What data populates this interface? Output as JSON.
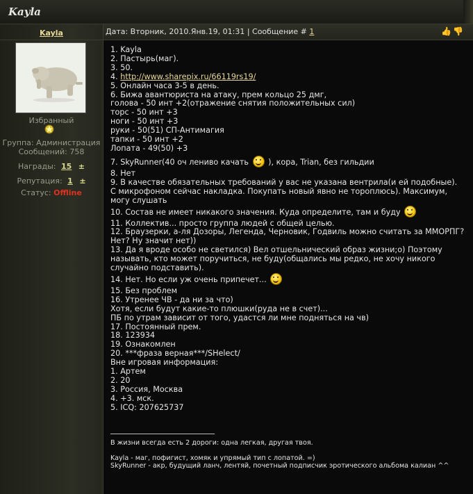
{
  "topbar": {
    "title": "Kayla"
  },
  "sidebar": {
    "username": "Kayla",
    "rank": "Избранный",
    "group_label": "Группа:",
    "group_value": "Администрация",
    "posts_label": "Сообщений:",
    "posts_value": "758",
    "awards_label": "Награды:",
    "awards_value": "15",
    "reputation_label": "Репутация:",
    "reputation_value": "1",
    "plus": "±",
    "status_label": "Статус:",
    "status_value": "Offline"
  },
  "post_header": {
    "date_text": "Дата: Вторник, 2010.Янв.19, 01:31 | Сообщение #",
    "message_number": "1"
  },
  "content": {
    "l1": "1. Kayla",
    "l2": "2. Пастырь(маг).",
    "l3": "3. 50.",
    "l4_prefix": "4. ",
    "l4_link": "http://www.sharepix.ru/66119rs19/",
    "l5": "5. Онлайн часа 3-5 в день.",
    "l6": "6. Бижа авантюриста на атаку, прем кольцо 25 дмг,",
    "l6b": "голова - 50 инт +2(отражение снятия положительных сил)",
    "l6c": "торс - 50 инт +3",
    "l6d": "ноги - 50 инт +3",
    "l6e": "руки - 50(51) СП-Антимагия",
    "l6f": "тапки - 50 инт +2",
    "l6g": "Лопата - 49(50) +3",
    "l7a": "7. SkyRunner(40 оч лениво качать",
    "l7b": "), кора, Trian, без гильдии",
    "l8": "8. Нет",
    "l9": "9. В качестве обязательных требований у вас не указана вентрила(и ей подобные). С микрофоном сейчас накладка. Покупать новый явно не тороплюсь). Максимум, могу слушать",
    "l10": "10. Состав не имеет никакого значения. Куда определите, там и буду",
    "l11": "11. Коллектив... просто группа людей с общей целью.",
    "l12": "12. Браузерки, а-ля Дозоры, Легенда, Черновик, Годвиль можно считать за ММОРПГ? Нет? Ну значит нет))",
    "l13": "13. Да я вроде особо не светился) Вел отшельнический образ жизни;о) Поэтому называть, кто может поручиться, не буду(общались мы редко, не хочу никого случайно подставить).",
    "l14": "14. Нет. Но если уж очень припечет...",
    "l15": "15. Без проблем",
    "l16": "16. Утренее ЧВ - да ни за что)",
    "l16b": "Хотя, если будут какие-то плюшки(руда не в счет)...",
    "l16c": "ПБ по утрам зависит от того, удастся ли мне подняться на чв)",
    "l17": "17. Постоянный прем.",
    "l18": "18. 123934",
    "l19": "19. Ознакомлен",
    "l20": "20. ***фраза верная***/SHelect/",
    "offgame": "Вне игровая информация:",
    "o1": "1. Артем",
    "o2": "2. 20",
    "o3": "3. Россия, Москва",
    "o4": "4. +3. мск.",
    "o5": "5. ICQ: 207625737"
  },
  "signature": {
    "s1": "В жизни всегда есть 2 дороги: одна легкая, другая твоя.",
    "s2": "Kayla - маг, пофигист, хомяк и упрямый тип с лопатой. =)",
    "s3": "SkyRunner - акр, будущий ланч, лентяй, почетный подписчик эротического альбома калиан ^^"
  }
}
